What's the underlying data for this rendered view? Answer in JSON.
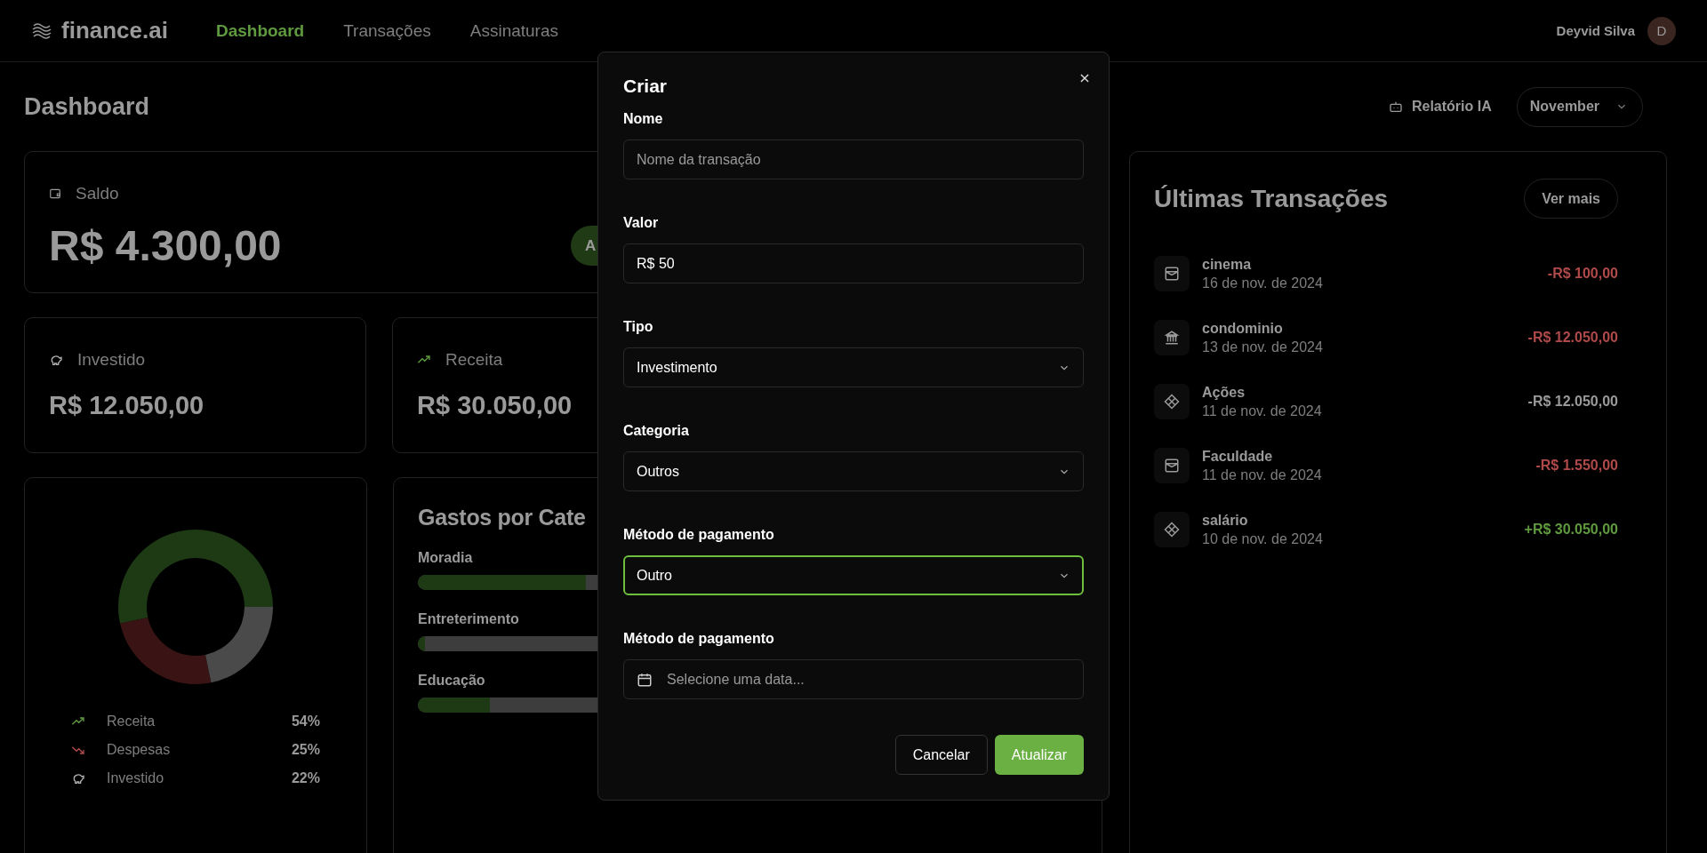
{
  "header": {
    "logo": "finance.ai",
    "nav": [
      {
        "label": "Dashboard",
        "selected": true
      },
      {
        "label": "Transações",
        "selected": false
      },
      {
        "label": "Assinaturas",
        "selected": false
      }
    ],
    "user": {
      "name": "Deyvid Silva",
      "initial": "D"
    }
  },
  "dashboard": {
    "title": "Dashboard",
    "report_button": "Relatório IA",
    "month_select": "November",
    "balance": {
      "label": "Saldo",
      "value": "R$ 4.300,00",
      "add_button": "A"
    },
    "summary": [
      {
        "kind": "invest",
        "label": "Investido",
        "value": "R$ 12.050,00"
      },
      {
        "kind": "income",
        "label": "Receita",
        "value": "R$ 30.050,00"
      }
    ],
    "legend": [
      {
        "kind": "income",
        "percent": "54%"
      },
      {
        "kind": "expense",
        "percent": "25%"
      },
      {
        "kind": "invest",
        "percent": "22%"
      }
    ],
    "chart_data": {
      "type": "donut",
      "categories": [
        "Receita",
        "Despesas",
        "Investido"
      ],
      "values": [
        54,
        25,
        22
      ]
    },
    "categories": {
      "title": "Gastos por Cate",
      "items": [
        {
          "name": "Moradia",
          "level": 0.93
        },
        {
          "name": "Entreterimento",
          "level": 0.04
        },
        {
          "name": "Educação",
          "level": 0.4
        }
      ]
    }
  },
  "transactions": {
    "title": "Últimas Transações",
    "more_button": "Ver mais",
    "items": [
      {
        "name": "cinema",
        "date": "16 de nov. de 2024",
        "amount": "-R$ 100,00",
        "color": "#b04a4a",
        "kind": "card"
      },
      {
        "name": "condominio",
        "date": "13 de nov. de 2024",
        "amount": "-R$ 12.050,00",
        "color": "#b04a4a",
        "kind": "bank"
      },
      {
        "name": "Ações",
        "date": "11 de nov. de 2024",
        "amount": "-R$ 12.050,00",
        "color": "#9a9a9a",
        "kind": "pix"
      },
      {
        "name": "Faculdade",
        "date": "11 de nov. de 2024",
        "amount": "-R$ 1.550,00",
        "color": "#b04a4a",
        "kind": "card"
      },
      {
        "name": "salário",
        "date": "10 de nov. de 2024",
        "amount": "+R$ 30.050,00",
        "color": "#5f9a3f",
        "kind": "pix"
      }
    ]
  },
  "dialog": {
    "title": "Criar",
    "fields": [
      {
        "kind": "text",
        "label": "Nome",
        "placeholder": "Nome da transação",
        "focused": false
      },
      {
        "kind": "text",
        "label": "Valor",
        "value": "R$ 50",
        "focused": false
      },
      {
        "kind": "select",
        "label": "Tipo",
        "value": "Investimento",
        "focused": false
      },
      {
        "kind": "select",
        "label": "Categoria",
        "value": "Outros",
        "focused": false
      },
      {
        "kind": "select",
        "label": "Método de pagamento",
        "value": "Outro",
        "focused": true
      },
      {
        "kind": "date",
        "label": "Método de pagamento",
        "placeholder": "Selecione uma data...",
        "focused": false
      }
    ],
    "cancel_button": "Cancelar",
    "submit_button": "Atualizar"
  }
}
